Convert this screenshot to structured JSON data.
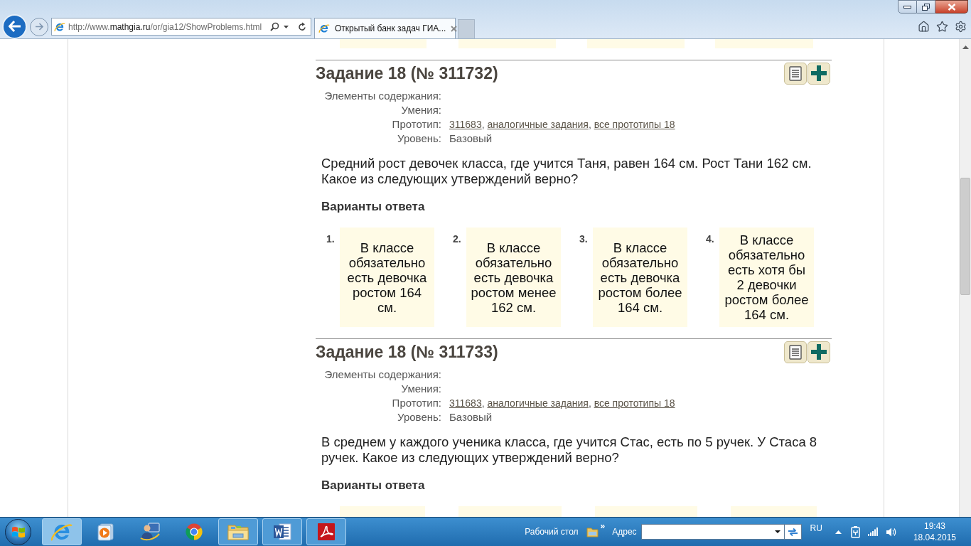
{
  "browser": {
    "address": {
      "prefix": "http://www.",
      "domain": "mathgia.ru",
      "path": "/or/gia12/ShowProblems.html"
    },
    "tabs": [
      {
        "title": "Открытый банк задач ГИА...",
        "selected": true
      }
    ]
  },
  "tasks": [
    {
      "title": "Задание 18 (№ 311732)",
      "meta": [
        {
          "label": "Элементы содержания:"
        },
        {
          "label": "Умения:"
        },
        {
          "label": "Прототип:",
          "links": [
            {
              "text": "311683",
              "after": ","
            },
            {
              "text": "аналогичные задания",
              "after": ","
            },
            {
              "text": "все прототипы 18"
            }
          ]
        },
        {
          "label": "Уровень:",
          "value": "Базовый"
        }
      ],
      "question": "Средний рост девочек класса, где учится Таня, равен 164 см. Рост Тани 162 см. Какое из следующих утверждений верно?",
      "options_heading": "Варианты ответа",
      "options": [
        {
          "number": "1.",
          "text": "В классе обязательно есть девочка ростом 164 см."
        },
        {
          "number": "2.",
          "text": "В классе обязательно есть девочка ростом менее 162 см."
        },
        {
          "number": "3.",
          "text": "В классе обязательно есть девочка ростом более 164 см."
        },
        {
          "number": "4.",
          "text": "В классе обязательно есть хотя бы 2 девочки ростом более 164 см."
        }
      ]
    },
    {
      "title": "Задание 18 (№ 311733)",
      "meta": [
        {
          "label": "Элементы содержания:"
        },
        {
          "label": "Умения:"
        },
        {
          "label": "Прототип:",
          "links": [
            {
              "text": "311683",
              "after": ","
            },
            {
              "text": "аналогичные задания",
              "after": ","
            },
            {
              "text": "все прототипы 18"
            }
          ]
        },
        {
          "label": "Уровень:",
          "value": "Базовый"
        }
      ],
      "question": "В среднем у каждого ученика класса, где учится Стас, есть по 5 ручек. У Стаса 8 ручек. Какое из следующих утверждений верно?",
      "options_heading": "Варианты ответа"
    }
  ],
  "taskbar": {
    "apps": [
      {
        "running": true,
        "selected": true
      },
      {
        "running": false,
        "selected": false
      },
      {
        "running": false,
        "selected": false
      },
      {
        "running": false,
        "selected": false
      },
      {
        "running": true,
        "selected": false
      },
      {
        "running": true,
        "selected": false
      },
      {
        "running": true,
        "selected": false
      }
    ],
    "toolbar_label": "Рабочий стол",
    "chevron": "»",
    "address_label": "Адрес",
    "language": "RU",
    "time": "19:43",
    "date": "18.04.2015"
  }
}
